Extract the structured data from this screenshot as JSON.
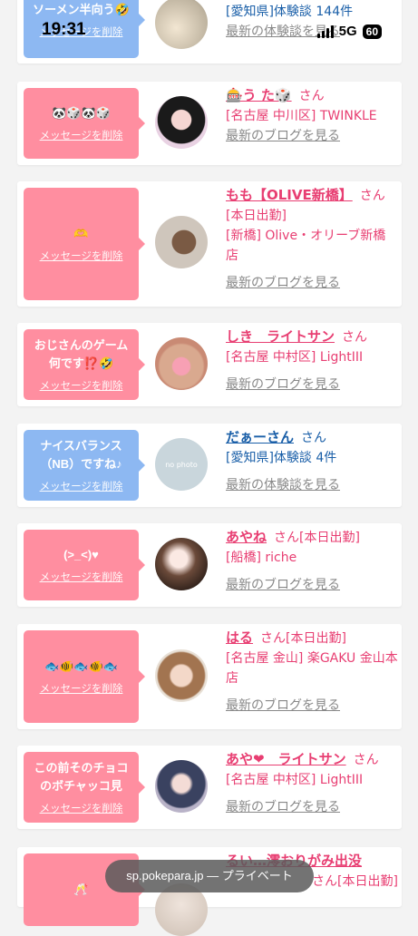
{
  "status": {
    "time": "19:31",
    "network": "5G",
    "battery": "60"
  },
  "browser": {
    "url": "sp.pokepara.jp",
    "mode": "— プライベート"
  },
  "cards": [
    {
      "message": "ソーメン半向う🤣",
      "delete": "メッセージを削除",
      "name": "",
      "san": "",
      "detail": "[愛知県]体験談 144件",
      "detail2": "",
      "more": "最新の体験談を見る"
    },
    {
      "message": "🐼🎲🐼🎲",
      "delete": "メッセージを削除",
      "name": "🎰う た🎲",
      "san": "さん",
      "detail": "[名古屋 中川区] TWINKLE",
      "detail2": "",
      "more": "最新のブログを見る"
    },
    {
      "message": "🫶",
      "delete": "メッセージを削除",
      "name": "もも【OLIVE新橋】",
      "san": "さん",
      "detail": "[本日出勤]",
      "detail2": "[新橋] Olive・オリーブ新橋店",
      "more": "最新のブログを見る"
    },
    {
      "message": "おじさんのゲーム何です⁉️🤣",
      "delete": "メッセージを削除",
      "name": "しき　ライトサン",
      "san": "さん",
      "detail": "[名古屋 中村区] LightIII",
      "detail2": "",
      "more": "最新のブログを見る"
    },
    {
      "message": "ナイスバランス（NB）ですね♪",
      "delete": "メッセージを削除",
      "name": "だぁーさん",
      "san": "さん",
      "detail": "[愛知県]体験談 4件",
      "detail2": "",
      "more": "最新の体験談を見る",
      "avatar_text": "no photo"
    },
    {
      "message": "(>_<)♥",
      "delete": "メッセージを削除",
      "name": "あやね",
      "san": "さん[本日出勤]",
      "detail": "[船橋] riche",
      "detail2": "",
      "more": "最新のブログを見る"
    },
    {
      "message": "🐟🐠🐟🐠🐟",
      "delete": "メッセージを削除",
      "name": "はる",
      "san": "さん[本日出勤]",
      "detail": "[名古屋 金山] 楽GAKU 金山本店",
      "detail2": "",
      "more": "最新のブログを見る"
    },
    {
      "message": "この前そのチョコのボチャッコ見",
      "delete": "メッセージを削除",
      "name": "あや❤︎　ライトサン",
      "san": "さん",
      "detail": "[名古屋 中村区] LightIII",
      "detail2": "",
      "more": "最新のブログを見る"
    },
    {
      "message": "🥂",
      "delete": "",
      "name": "るい…澪おりがみ出没",
      "san": "さん[本日出勤]",
      "detail": "",
      "detail2": "",
      "more": ""
    }
  ],
  "colors": {
    "pink": "#ff8ea0",
    "blue": "#8db8f2",
    "link_pink": "#e83e72",
    "link_blue": "#1a5fa8"
  }
}
